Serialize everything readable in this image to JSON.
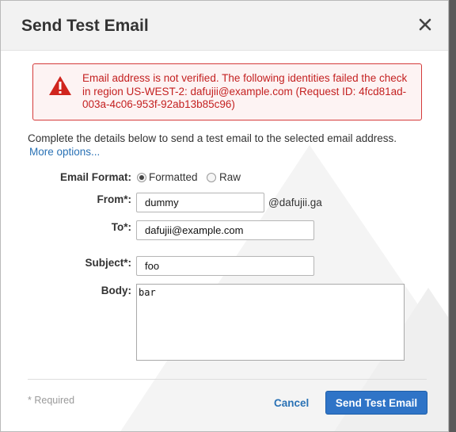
{
  "dialog": {
    "title": "Send Test Email",
    "close_icon": "close-icon"
  },
  "alert": {
    "icon": "warning-icon",
    "message": "Email address is not verified. The following identities failed the check in region US-WEST-2: dafujii@example.com (Request ID: 4fcd81ad-003a-4c06-953f-92ab13b85c96)"
  },
  "intro": {
    "text": "Complete the details below to send a test email to the selected email address.",
    "more_options": "More options..."
  },
  "form": {
    "format_label": "Email Format:",
    "format_options": [
      {
        "label": "Formatted",
        "selected": true
      },
      {
        "label": "Raw",
        "selected": false
      }
    ],
    "from_label": "From*:",
    "from_value": "dummy",
    "from_domain": "@dafujii.ga",
    "to_label": "To*:",
    "to_value": "dafujii@example.com",
    "subject_label": "Subject*:",
    "subject_value": "foo",
    "body_label": "Body:",
    "body_value": "bar"
  },
  "footer": {
    "required_note": "* Required",
    "cancel_label": "Cancel",
    "send_label": "Send Test Email"
  },
  "colors": {
    "primary": "#2f74c7",
    "link": "#2a72b5",
    "error": "#c42121"
  }
}
